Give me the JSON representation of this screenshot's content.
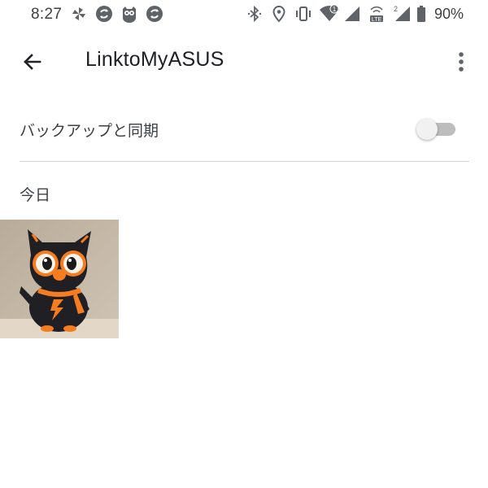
{
  "status_bar": {
    "time": "8:27",
    "battery_percent": "90%",
    "left_icons": [
      "pinwheel-icon",
      "sync-notification-icon",
      "mascot-notification-icon",
      "sync-notification-icon"
    ],
    "right_icons": [
      "bluetooth-icon",
      "location-icon",
      "vibrate-icon",
      "wifi-icon",
      "signal-icon",
      "volte-lte-icon",
      "signal-icon",
      "battery-icon"
    ],
    "wifi_badge": "1",
    "sim2_badge": "2",
    "volte_label": "LTE"
  },
  "app_bar": {
    "title": "LinktoMyASUS",
    "back_icon": "arrow-back-icon",
    "menu_icon": "more-vert-icon"
  },
  "settings": {
    "backup_sync_label": "バックアップと同期",
    "backup_sync_enabled": false
  },
  "sections": [
    {
      "header": "今日",
      "photos": [
        {
          "subject": "black owl plush toy with orange accents"
        }
      ]
    }
  ],
  "colors": {
    "background": "#ffffff",
    "text_primary": "#202124",
    "text_secondary": "#3c4043",
    "toggle_track_off": "#bdbdbd",
    "toggle_thumb_off": "#f1f1f1",
    "divider": "#d0d0d0",
    "accent_orange": "#f57c1f"
  }
}
